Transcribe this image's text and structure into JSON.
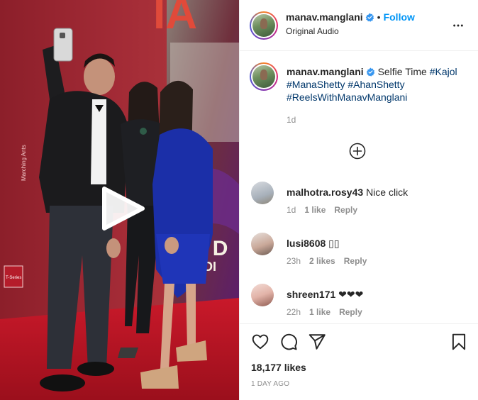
{
  "post": {
    "author": "manav.manglani",
    "follow_label": "Follow",
    "separator": "•",
    "audio": "Original Audio",
    "caption_user": "manav.manglani",
    "caption_text": "Selfie Time",
    "hashtags": [
      "#Kajol",
      "#ManaShetty",
      "#AhanShetty",
      "#ReelsWithManavManglani"
    ],
    "caption_time": "1d"
  },
  "media": {
    "watermark_text": "Marching Ants",
    "logo_text": "T-Series",
    "backdrop_letters": "IA",
    "backdrop_mid_letters": "P D",
    "backdrop_top": "I N",
    "backdrop_bottom": "IDI"
  },
  "comments": [
    {
      "user": "malhotra.rosy43",
      "text": "Nice click",
      "time": "1d",
      "likes": "1 like",
      "reply": "Reply"
    },
    {
      "user": "lusi8608",
      "text": "▯▯",
      "time": "23h",
      "likes": "2 likes",
      "reply": "Reply"
    },
    {
      "user": "shreen171",
      "text": "❤❤❤",
      "time": "22h",
      "likes": "1 like",
      "reply": "Reply"
    }
  ],
  "footer": {
    "likes": "18,177 likes",
    "timestamp": "1 DAY AGO"
  },
  "colors": {
    "link_blue": "#0095f6",
    "hashtag": "#00376b",
    "muted": "#8e8e8e",
    "verified": "#3897f0"
  },
  "icons": [
    "play-icon",
    "more-options-icon",
    "verified-icon",
    "add-circle-icon",
    "heart-icon",
    "comment-icon",
    "share-icon",
    "bookmark-icon"
  ]
}
